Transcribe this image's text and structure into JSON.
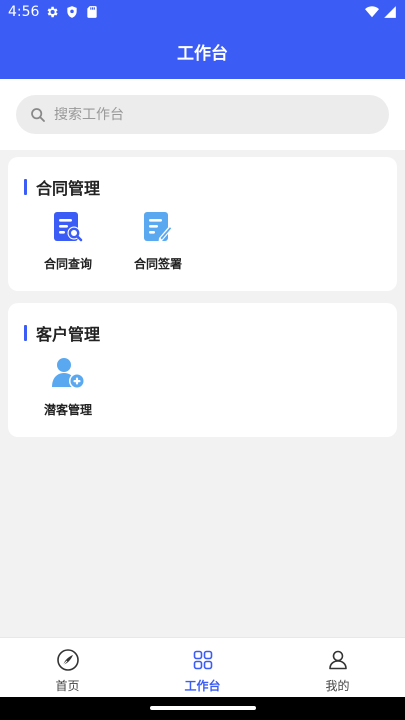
{
  "status_bar": {
    "time": "4:56",
    "icons": [
      "gear-icon",
      "shield-icon",
      "sd-card-icon",
      "wifi-icon",
      "signal-icon"
    ]
  },
  "header": {
    "title": "工作台"
  },
  "search": {
    "placeholder": "搜索工作台",
    "value": ""
  },
  "sections": [
    {
      "title": "合同管理",
      "items": [
        {
          "label": "合同查询",
          "icon": "document-search-icon"
        },
        {
          "label": "合同签署",
          "icon": "document-edit-icon"
        }
      ]
    },
    {
      "title": "客户管理",
      "items": [
        {
          "label": "潜客管理",
          "icon": "add-user-icon"
        }
      ]
    }
  ],
  "bottom_nav": {
    "items": [
      {
        "label": "首页",
        "icon": "home-logo-icon",
        "active": false
      },
      {
        "label": "工作台",
        "icon": "grid-icon",
        "active": true
      },
      {
        "label": "我的",
        "icon": "user-icon",
        "active": false
      }
    ]
  },
  "colors": {
    "primary": "#3b5cf5",
    "icon_dark_blue": "#3b5cf5",
    "icon_light_blue": "#5aa9f0",
    "background": "#f2f2f2"
  }
}
